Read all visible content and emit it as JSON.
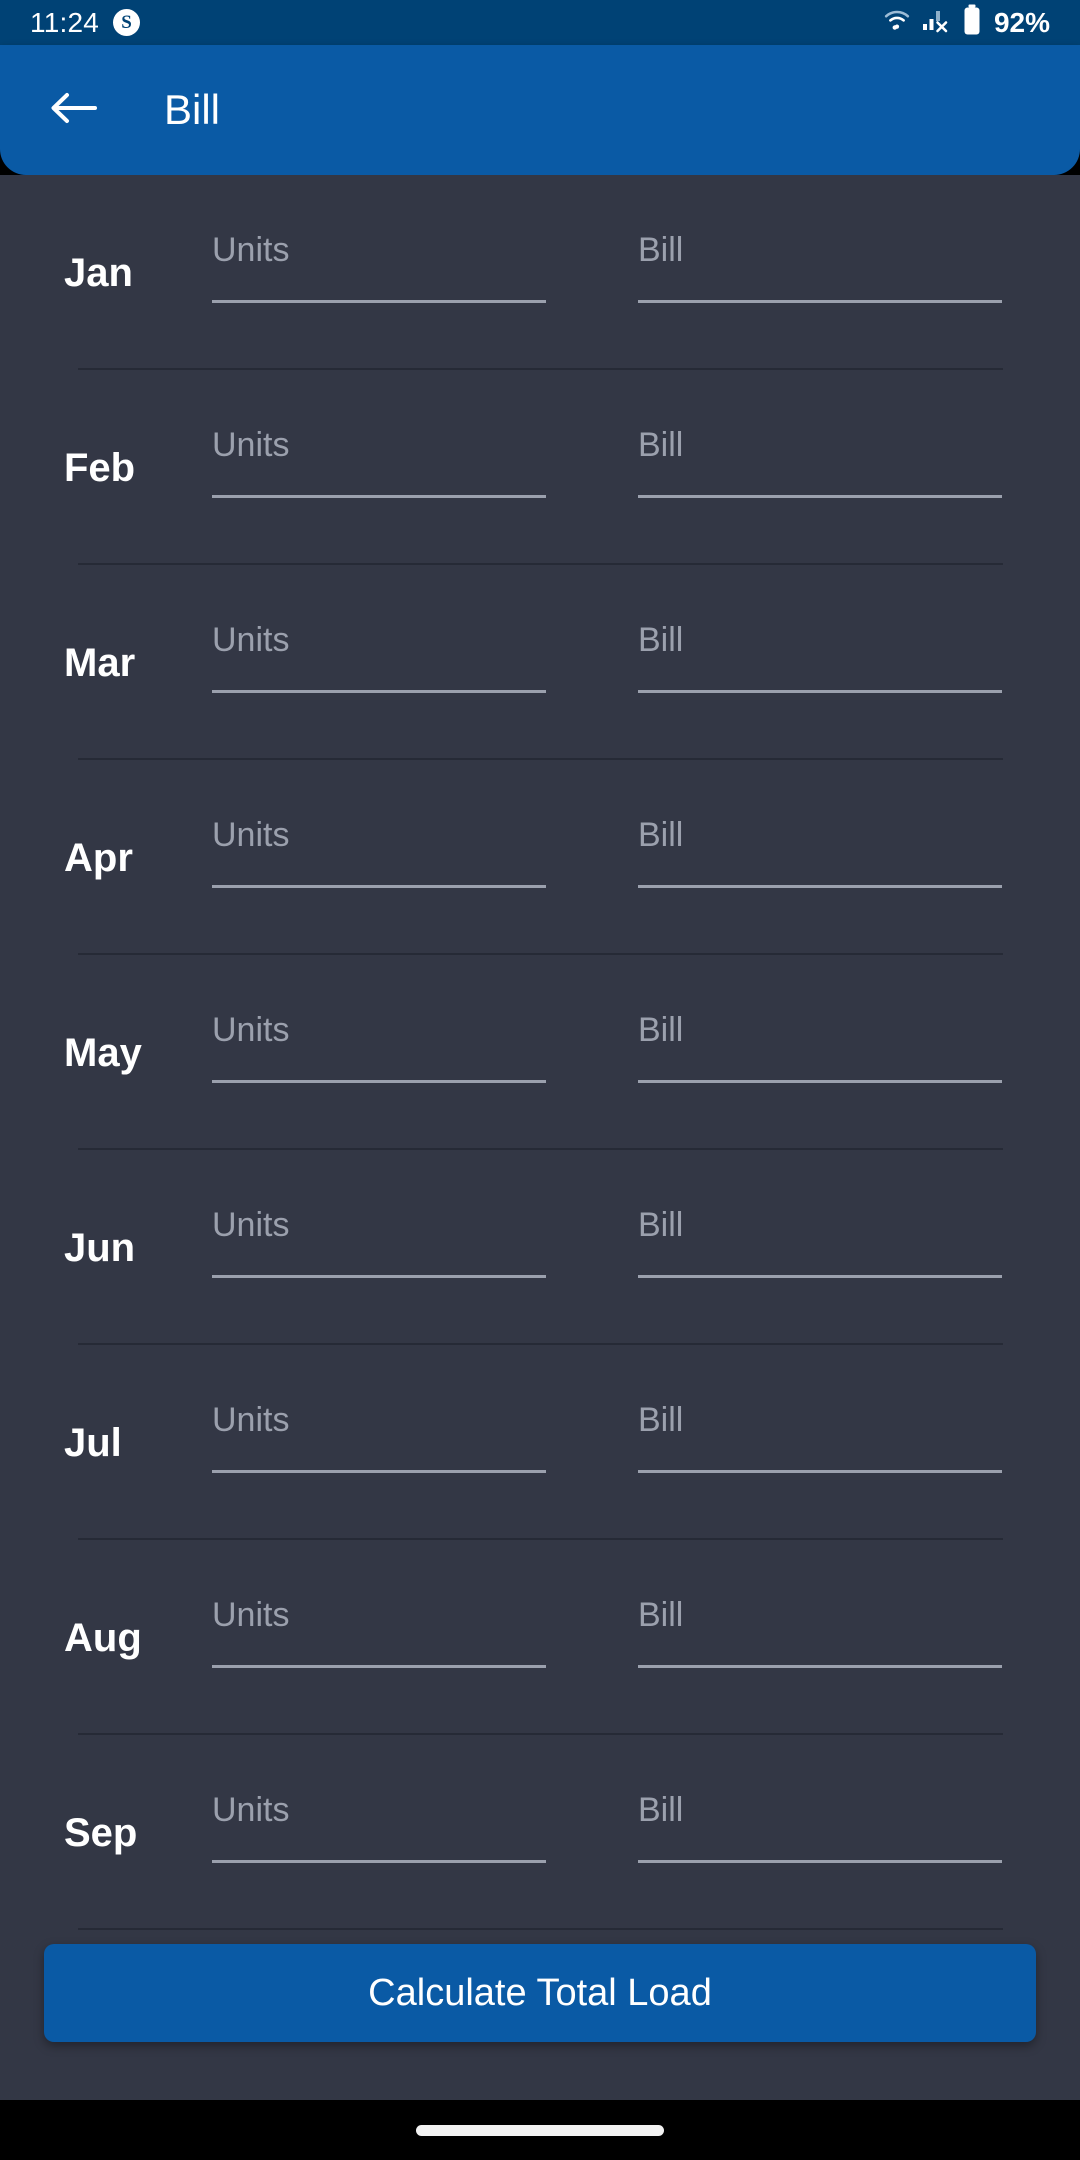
{
  "status_bar": {
    "time": "11:24",
    "app_icon_glyph": "S",
    "app_icon_name": "app-badge-icon",
    "wifi_icon_name": "wifi-icon",
    "cellular_icon_name": "cellular-no-sim-icon",
    "battery_icon_name": "battery-icon",
    "battery_percent": "92%",
    "background_color": "#004275"
  },
  "app_bar": {
    "back_icon_name": "back-arrow-icon",
    "title": "Bill",
    "background_color": "#0A5AA5"
  },
  "content": {
    "background_color": "#333745",
    "units_placeholder": "Units",
    "bill_placeholder": "Bill",
    "rows": [
      {
        "month": "Jan",
        "units_value": "",
        "bill_value": ""
      },
      {
        "month": "Feb",
        "units_value": "",
        "bill_value": ""
      },
      {
        "month": "Mar",
        "units_value": "",
        "bill_value": ""
      },
      {
        "month": "Apr",
        "units_value": "",
        "bill_value": ""
      },
      {
        "month": "May",
        "units_value": "",
        "bill_value": ""
      },
      {
        "month": "Jun",
        "units_value": "",
        "bill_value": ""
      },
      {
        "month": "Jul",
        "units_value": "",
        "bill_value": ""
      },
      {
        "month": "Aug",
        "units_value": "",
        "bill_value": ""
      },
      {
        "month": "Sep",
        "units_value": "",
        "bill_value": ""
      }
    ]
  },
  "footer": {
    "calculate_button_label": "Calculate Total Load",
    "button_color": "#0A5AA5"
  },
  "nav_bar": {
    "gesture_pill_name": "home-gesture-pill",
    "background_color": "#000000"
  }
}
